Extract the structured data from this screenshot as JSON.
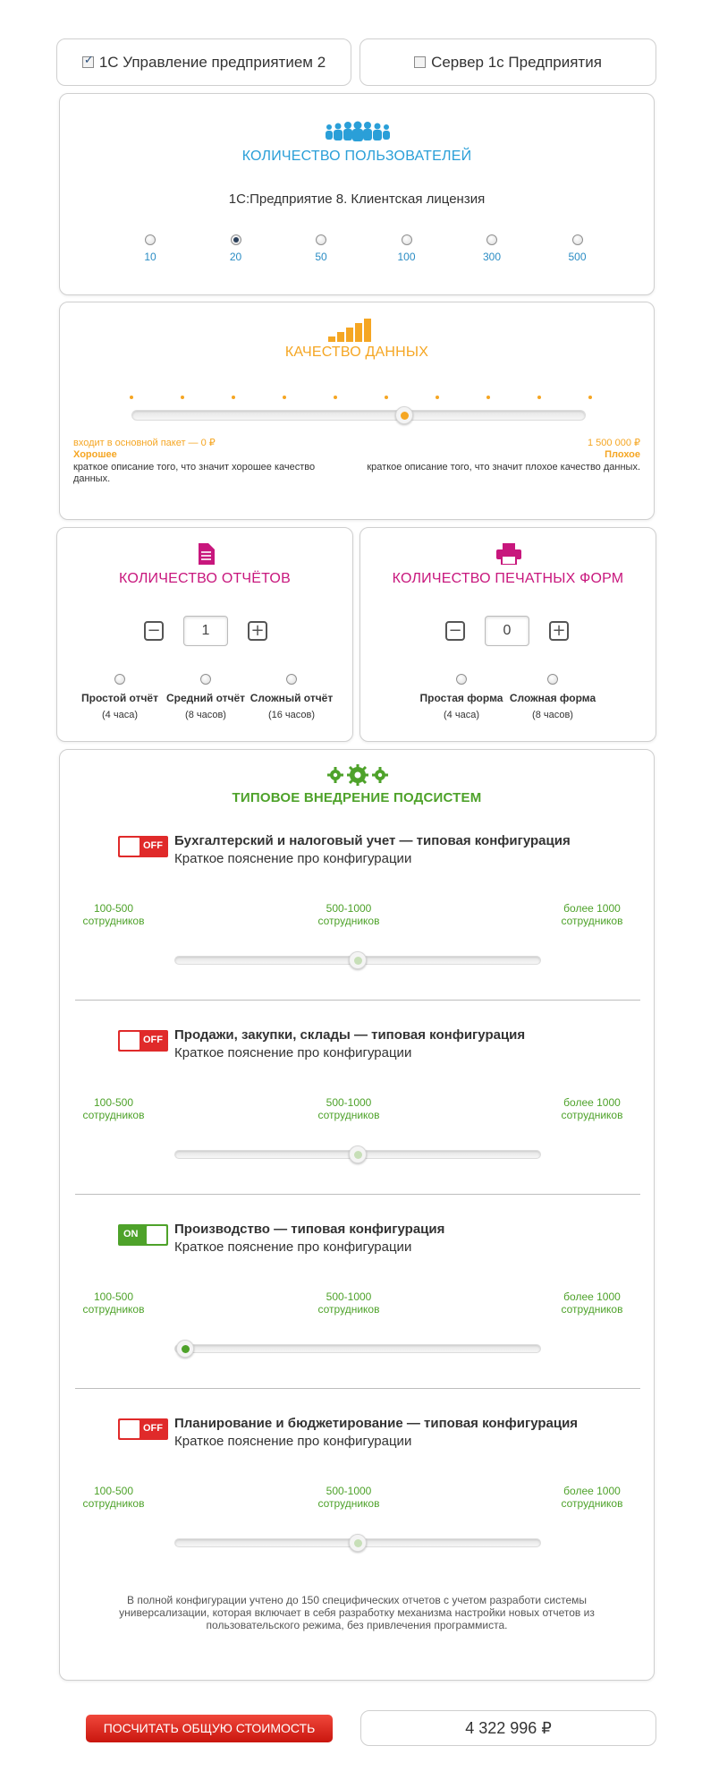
{
  "tabs": [
    {
      "label": "1С Управление предприятием 2",
      "checked": true
    },
    {
      "label": "Сервер 1с Предприятия",
      "checked": false
    }
  ],
  "users": {
    "title": "КОЛИЧЕСТВО ПОЛЬЗОВАТЕЛЕЙ",
    "subtitle": "1С:Предприятие 8. Клиентская лицензия",
    "options": [
      "10",
      "20",
      "50",
      "100",
      "300",
      "500"
    ],
    "selected": "20",
    "icon": "users-icon",
    "color": "#2a9fd8"
  },
  "quality": {
    "title": "КАЧЕСТВО ДАННЫХ",
    "icon": "bar-chart-icon",
    "color": "#f5a623",
    "slider_value": 0.6,
    "left_price": "входит в основной пакет — 0 ₽",
    "left_label": "Хорошее",
    "left_desc": "краткое описание того, что значит хорошее качество данных.",
    "right_price": "1 500 000 ₽",
    "right_label": "Плохое",
    "right_desc": "краткое описание того, что значит плохое качество данных."
  },
  "reports": {
    "title": "КОЛИЧЕСТВО ОТЧЁТОВ",
    "icon": "document-icon",
    "color": "#c8177d",
    "count": "1",
    "options": [
      {
        "label": "Простой отчёт",
        "sub": "(4 часа)"
      },
      {
        "label": "Средний отчёт",
        "sub": "(8 часов)"
      },
      {
        "label": "Сложный отчёт",
        "sub": "(16 часов)"
      }
    ]
  },
  "print_forms": {
    "title": "КОЛИЧЕСТВО ПЕЧАТНЫХ ФОРМ",
    "icon": "printer-icon",
    "count": "0",
    "options": [
      {
        "label": "Простая форма",
        "sub": "(4 часа)"
      },
      {
        "label": "Сложная форма",
        "sub": "(8 часов)"
      }
    ]
  },
  "subsystems": {
    "title": "ТИПОВОЕ ВНЕДРЕНИЕ ПОДСИСТЕМ",
    "icon": "gears-icon",
    "color": "#4ea22a",
    "on_label": "ON",
    "off_label": "OFF",
    "ranges": [
      "100-500\nсотрудников",
      "500-1000\nсотрудников",
      "более 1000\nсотрудников"
    ],
    "items": [
      {
        "title": "Бухгалтерский и налоговый учет — типовая конфигурация",
        "desc": "Краткое пояснение про конфигурации",
        "on": false,
        "slider_value": 0.5
      },
      {
        "title": "Продажи, закупки, склады — типовая конфигурация",
        "desc": "Краткое пояснение про конфигурации",
        "on": false,
        "slider_value": 0.5
      },
      {
        "title": "Производство — типовая конфигурация",
        "desc": "Краткое пояснение про конфигурации",
        "on": true,
        "slider_value": 0.0
      },
      {
        "title": "Планирование и бюджетирование — типовая конфигурация",
        "desc": "Краткое пояснение про конфигурации",
        "on": false,
        "slider_value": 0.5
      }
    ],
    "note": "В полной конфигурации учтено до 150 специфических отчетов с учетом разработи системы универсализации, которая включает в себя разработку механизма настройки новых отчетов из пользовательского режима, без привлечения программиста."
  },
  "footer": {
    "calc_button": "ПОСЧИТАТЬ ОБЩУЮ СТОИМОСТЬ",
    "total": "4 322 996 ₽"
  }
}
